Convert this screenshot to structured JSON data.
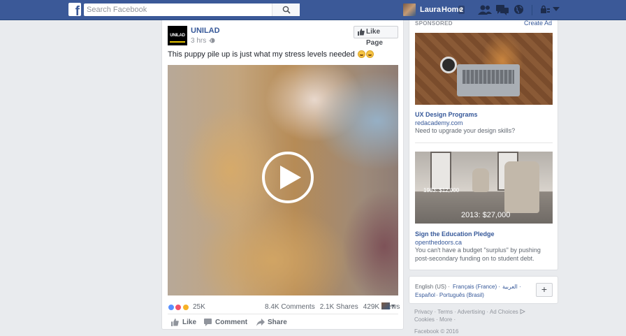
{
  "topbar": {
    "search_placeholder": "Search Facebook",
    "user_name": "Laura",
    "home_label": "Home",
    "home_badge": "2"
  },
  "post": {
    "page_name": "UNILAD",
    "page_avatar_text": "UNILAD",
    "time": "3 hrs ·",
    "like_page_label": "Like Page",
    "text": "This puppy pile up is just what my stress levels needed",
    "reaction_count": "25K",
    "comments": "8.4K Comments",
    "shares": "2.1K Shares",
    "views": "429K Views",
    "actions": {
      "like": "Like",
      "comment": "Comment",
      "share": "Share"
    }
  },
  "sidebar": {
    "sponsored_label": "SPONSORED",
    "create_ad": "Create Ad",
    "ads": [
      {
        "headline": "UX Design Programs",
        "domain": "redacademy.com",
        "description": "Need to upgrade your design skills?"
      },
      {
        "headline": "Sign the Education Pledge",
        "domain": "openthedoors.ca",
        "description": "You can't have a budget \"surplus\" by pushing post-secondary funding on to student debt.",
        "image_label_1": "1983: $12,000",
        "image_label_2": "2013: $27,000"
      }
    ],
    "languages": {
      "current": "English (US) ·",
      "links": [
        "Français (France) ·",
        "العربية ·",
        "Español",
        "· Português (Brasil)"
      ],
      "add_label": "+"
    },
    "footer": {
      "line1": "Privacy · Terms · Advertising · Ad Choices",
      "line2": "Cookies · More ·",
      "copyright": "Facebook © 2016"
    }
  },
  "colors": {
    "brand_blue": "#3b5998",
    "link_blue": "#365899",
    "page_bg": "#e9ebee"
  }
}
